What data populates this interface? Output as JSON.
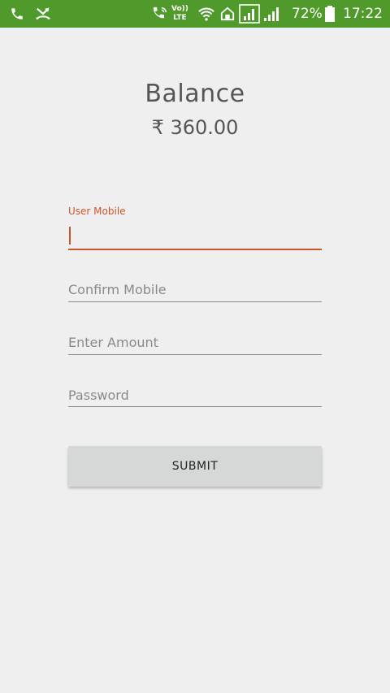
{
  "status_bar": {
    "network_label_line1": "Vo))",
    "network_label_line2": "LTE",
    "battery_percent": "72%",
    "time": "17:22",
    "background_color": "#4f9a2b"
  },
  "balance": {
    "title": "Balance",
    "amount": "₹ 360.00"
  },
  "form": {
    "user_mobile": {
      "label": "User Mobile",
      "value": "",
      "accent_color": "#c9562b"
    },
    "confirm_mobile": {
      "placeholder": "Confirm Mobile"
    },
    "amount": {
      "placeholder": "Enter Amount"
    },
    "password": {
      "placeholder": "Password"
    },
    "submit_label": "SUBMIT"
  },
  "icons": [
    "phone-icon",
    "missed-call-icon",
    "wifi-calling-icon",
    "volte-icon",
    "wifi-icon",
    "home-icon",
    "signal-icon",
    "signal-icon-2",
    "battery-icon"
  ]
}
